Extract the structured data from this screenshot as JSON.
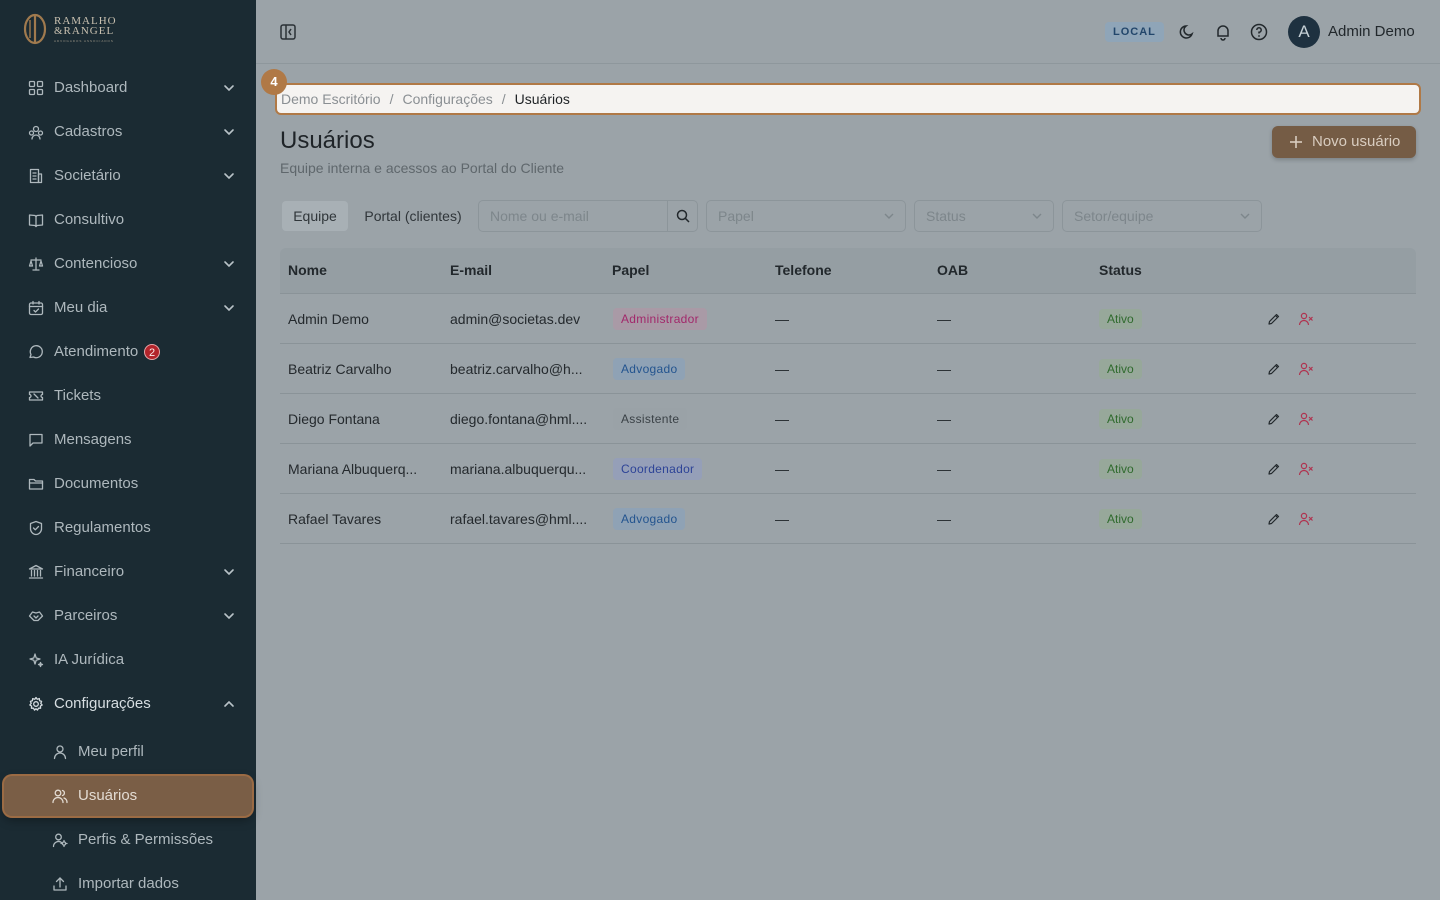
{
  "brand": {
    "line1": "RAMALHO",
    "line2": "&RANGEL",
    "tagline": "ADVOGADOS ASSOCIADOS"
  },
  "sidebar": {
    "items": [
      {
        "label": "Dashboard",
        "icon": "grid-icon",
        "chevron": "down"
      },
      {
        "label": "Cadastros",
        "icon": "users-group-icon",
        "chevron": "down"
      },
      {
        "label": "Societário",
        "icon": "building-icon",
        "chevron": "down"
      },
      {
        "label": "Consultivo",
        "icon": "book-open-icon",
        "chevron": ""
      },
      {
        "label": "Contencioso",
        "icon": "scale-icon",
        "chevron": "down"
      },
      {
        "label": "Meu dia",
        "icon": "calendar-icon",
        "chevron": "down"
      },
      {
        "label": "Atendimento",
        "icon": "chat-bubble-icon",
        "chevron": "",
        "badge": "2"
      },
      {
        "label": "Tickets",
        "icon": "ticket-icon",
        "chevron": ""
      },
      {
        "label": "Mensagens",
        "icon": "message-square-icon",
        "chevron": ""
      },
      {
        "label": "Documentos",
        "icon": "folder-icon",
        "chevron": ""
      },
      {
        "label": "Regulamentos",
        "icon": "shield-icon",
        "chevron": ""
      },
      {
        "label": "Financeiro",
        "icon": "bank-icon",
        "chevron": "down"
      },
      {
        "label": "Parceiros",
        "icon": "handshake-icon",
        "chevron": "down"
      },
      {
        "label": "IA Jurídica",
        "icon": "sparkles-icon",
        "chevron": ""
      },
      {
        "label": "Configurações",
        "icon": "gear-icon",
        "chevron": "up"
      }
    ],
    "subitems": [
      {
        "label": "Meu perfil",
        "icon": "user-icon"
      },
      {
        "label": "Usuários",
        "icon": "users-icon",
        "active": true
      },
      {
        "label": "Perfis & Permissões",
        "icon": "user-cog-icon"
      },
      {
        "label": "Importar dados",
        "icon": "upload-icon"
      }
    ]
  },
  "topbar": {
    "env": "LOCAL",
    "user_name": "Admin Demo",
    "avatar_letter": "A"
  },
  "breadcrumb": {
    "items": [
      "Demo Escritório",
      "Configurações",
      "Usuários"
    ],
    "separator": "/"
  },
  "step_marker": "4",
  "page": {
    "title": "Usuários",
    "subtitle": "Equipe interna e acessos ao Portal do Cliente",
    "new_button": "Novo usuário"
  },
  "filters": {
    "tabs": [
      "Equipe",
      "Portal (clientes)"
    ],
    "search_placeholder": "Nome ou e-mail",
    "role_placeholder": "Papel",
    "status_placeholder": "Status",
    "team_placeholder": "Setor/equipe"
  },
  "table": {
    "headers": [
      "Nome",
      "E-mail",
      "Papel",
      "Telefone",
      "OAB",
      "Status"
    ],
    "rows": [
      {
        "name": "Admin Demo",
        "email": "admin@societas.dev",
        "role": "Administrador",
        "role_color": "pink",
        "phone": "—",
        "oab": "—",
        "status": "Ativo"
      },
      {
        "name": "Beatriz Carvalho",
        "email": "beatriz.carvalho@h...",
        "role": "Advogado",
        "role_color": "blue",
        "phone": "—",
        "oab": "—",
        "status": "Ativo"
      },
      {
        "name": "Diego Fontana",
        "email": "diego.fontana@hml....",
        "role": "Assistente",
        "role_color": "gray",
        "phone": "—",
        "oab": "—",
        "status": "Ativo"
      },
      {
        "name": "Mariana Albuquerq...",
        "email": "mariana.albuquerqu...",
        "role": "Coordenador",
        "role_color": "indigo",
        "phone": "—",
        "oab": "—",
        "status": "Ativo"
      },
      {
        "name": "Rafael Tavares",
        "email": "rafael.tavares@hml....",
        "role": "Advogado",
        "role_color": "blue",
        "phone": "—",
        "oab": "—",
        "status": "Ativo"
      }
    ]
  },
  "colors": {
    "sidebar_bg": "#1b2b33",
    "accent": "#b07946",
    "active_item": "#7a5e46",
    "status_active": "#2f6a2d"
  }
}
